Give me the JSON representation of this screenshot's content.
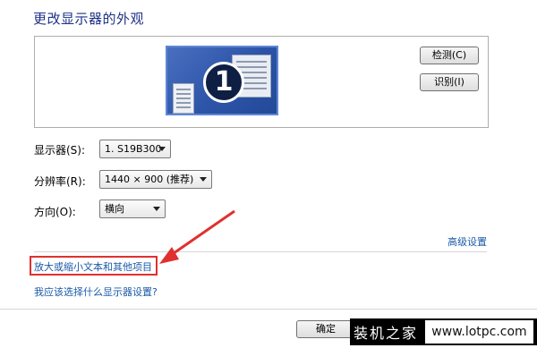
{
  "header": {
    "title": "更改显示器的外观"
  },
  "preview": {
    "monitor_number": "1",
    "detect_label": "检测(C)",
    "identify_label": "识别(I)"
  },
  "settings": {
    "display": {
      "label": "显示器(S):",
      "value": "1. S19B300"
    },
    "resolution": {
      "label": "分辨率(R):",
      "value": "1440 × 900 (推荐)"
    },
    "orientation": {
      "label": "方向(O):",
      "value": "横向"
    }
  },
  "links": {
    "advanced": "高级设置",
    "text_size": "放大或缩小文本和其他项目",
    "help": "我应该选择什么显示器设置?"
  },
  "footer": {
    "ok_label": "确定"
  },
  "watermark": {
    "brand": "装机之家",
    "url": "www.lotpc.com"
  },
  "annotation": {
    "highlight_color": "#e03030"
  }
}
